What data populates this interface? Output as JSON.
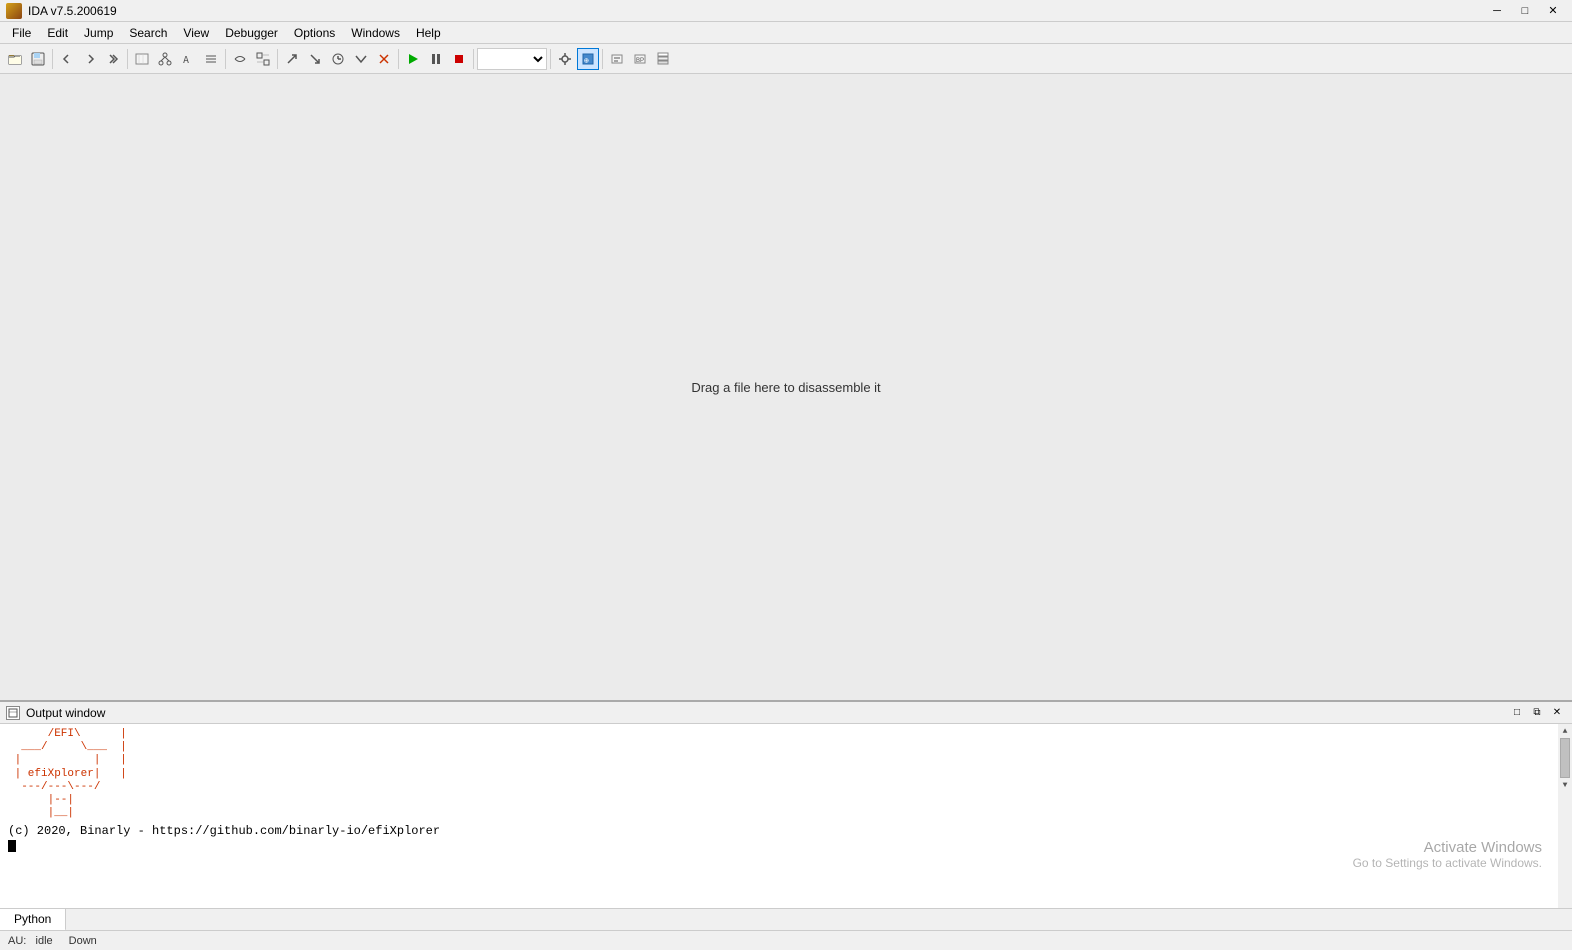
{
  "titleBar": {
    "title": "IDA v7.5.200619",
    "iconAlt": "IDA icon",
    "controls": {
      "minimize": "─",
      "maximize": "□",
      "close": "✕"
    }
  },
  "menuBar": {
    "items": [
      "File",
      "Edit",
      "Jump",
      "Search",
      "View",
      "Debugger",
      "Options",
      "Windows",
      "Help"
    ]
  },
  "toolbar": {
    "groups": []
  },
  "mainArea": {
    "dropHint": "Drag a file here to disassemble it"
  },
  "outputPanel": {
    "title": "Output window",
    "asciiArt": "      /EFI\\   |\n  ___/     \\  |\n |efiXplorer|\n  ---/---\\--/ \n      |--|\n      |__|",
    "asciiArtFull": "      /EFI\\      |\n  ___/     \\___  |\n |           |  |\n | efiXplorer|  |\n  ---/---\\---/  \n      |--|\n      |__|",
    "credit": "(c) 2020, Binarly - https://github.com/binarly-io/efiXplorer",
    "tabs": [
      "Python"
    ],
    "controls": {
      "maximize": "□",
      "restore": "⧉",
      "close": "✕"
    }
  },
  "statusBar": {
    "au": "AU:",
    "idle": "idle",
    "down": "Down"
  },
  "activateWindows": {
    "title": "Activate Windows",
    "subtitle": "Go to Settings to activate Windows."
  }
}
